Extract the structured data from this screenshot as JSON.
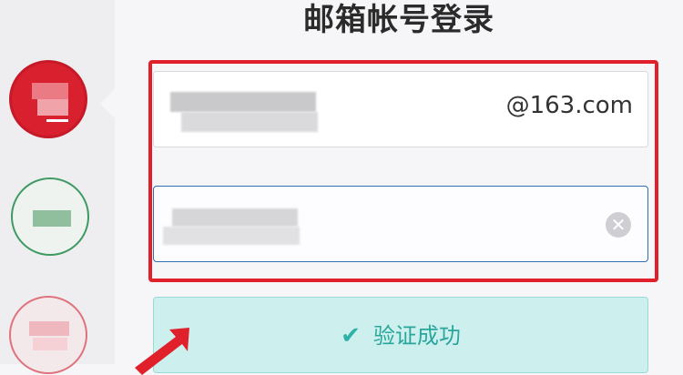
{
  "page": {
    "title": "邮箱帐号登录"
  },
  "providers": [
    {
      "name": "provider-163",
      "color": "#d8202f"
    },
    {
      "name": "provider-green",
      "color": "#3f9a62"
    },
    {
      "name": "provider-pink",
      "color": "#e0727c"
    }
  ],
  "email_field": {
    "suffix": "@163.com",
    "value_state": "blurred"
  },
  "password_field": {
    "value_state": "blurred",
    "clear_icon": "clear-circle-icon"
  },
  "verify_button": {
    "label": "验证成功",
    "icon": "check-icon"
  },
  "colors": {
    "highlight": "#e0202a",
    "focus_border": "#2f6fb4",
    "success_bg": "#cdf0ee",
    "success_text": "#2aa69c"
  }
}
